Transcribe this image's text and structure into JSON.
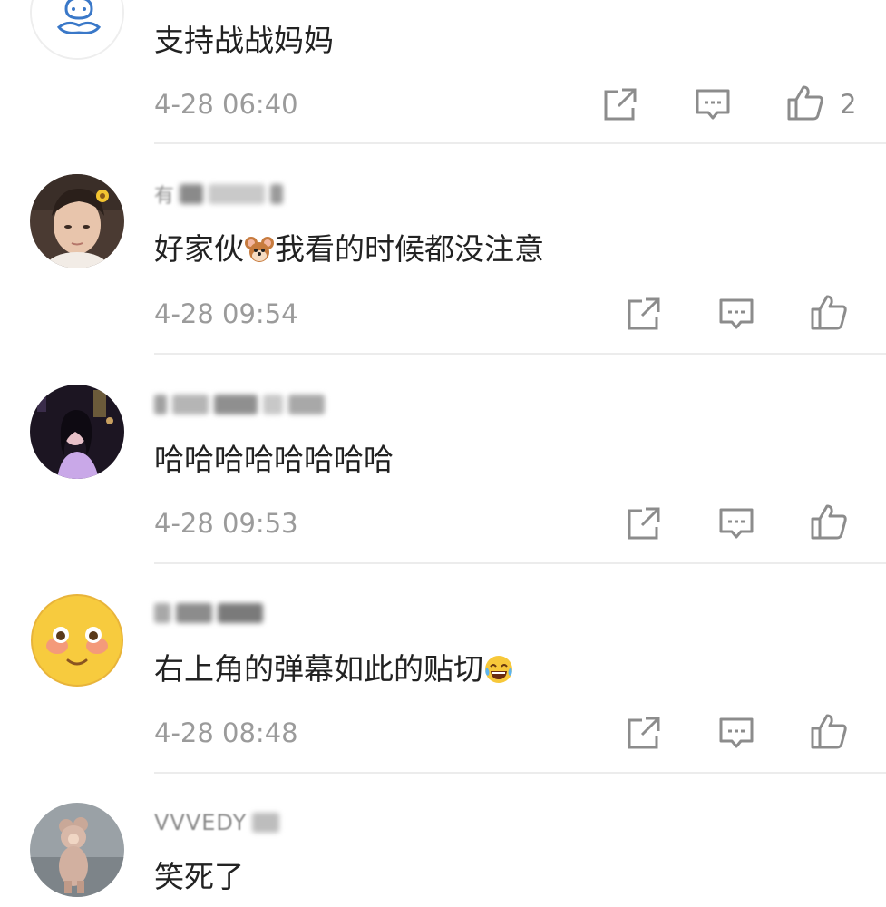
{
  "comments": [
    {
      "text": "支持战战妈妈",
      "time": "4-28 06:40",
      "likes": "2",
      "avatar": "cartoon-bunny-avatar"
    },
    {
      "username": "有",
      "text_before": "好家伙",
      "text_after": "我看的时候都没注意",
      "inline_emoji": "jerry-mouse-emoji",
      "time": "4-28 09:54",
      "avatar": "young-man-photo-avatar"
    },
    {
      "text": "哈哈哈哈哈哈哈哈",
      "time": "4-28 09:53",
      "avatar": "woman-night-photo-avatar"
    },
    {
      "text": "右上角的弹幕如此的贴切",
      "inline_emoji": "tears-of-joy-emoji",
      "time": "4-28 08:48",
      "avatar": "blushing-face-emoji-avatar"
    },
    {
      "username": "VVVEDY",
      "text": "笑死了",
      "avatar": "child-in-bear-costume-avatar"
    }
  ],
  "colors": {
    "text": "#222222",
    "meta": "#9b9b9b",
    "icon": "#8c8c8c",
    "divider": "#ececec"
  }
}
